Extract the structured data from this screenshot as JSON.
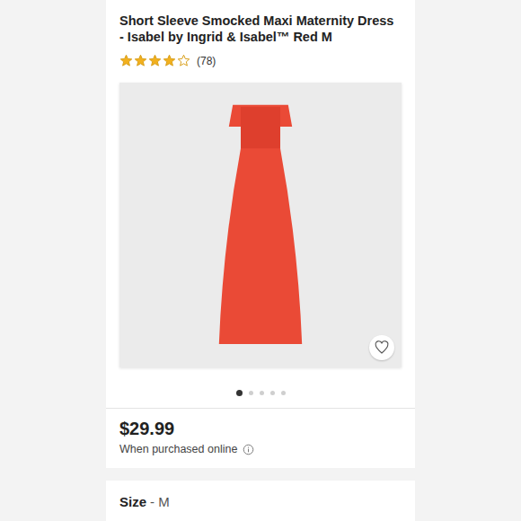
{
  "product": {
    "title": "Short Sleeve Smocked Maxi Maternity Dress - Isabel by Ingrid & Isabel™ Red M",
    "rating": {
      "stars": 4,
      "max": 5,
      "count": "(78)"
    },
    "favorite": false
  },
  "carousel": {
    "dots": [
      {
        "selected": true
      },
      {
        "selected": false
      },
      {
        "selected": false
      },
      {
        "selected": false
      },
      {
        "selected": false
      }
    ]
  },
  "price": {
    "amount": "$29.99",
    "note": "When purchased online"
  },
  "size": {
    "label": "Size",
    "value": "- M"
  }
}
